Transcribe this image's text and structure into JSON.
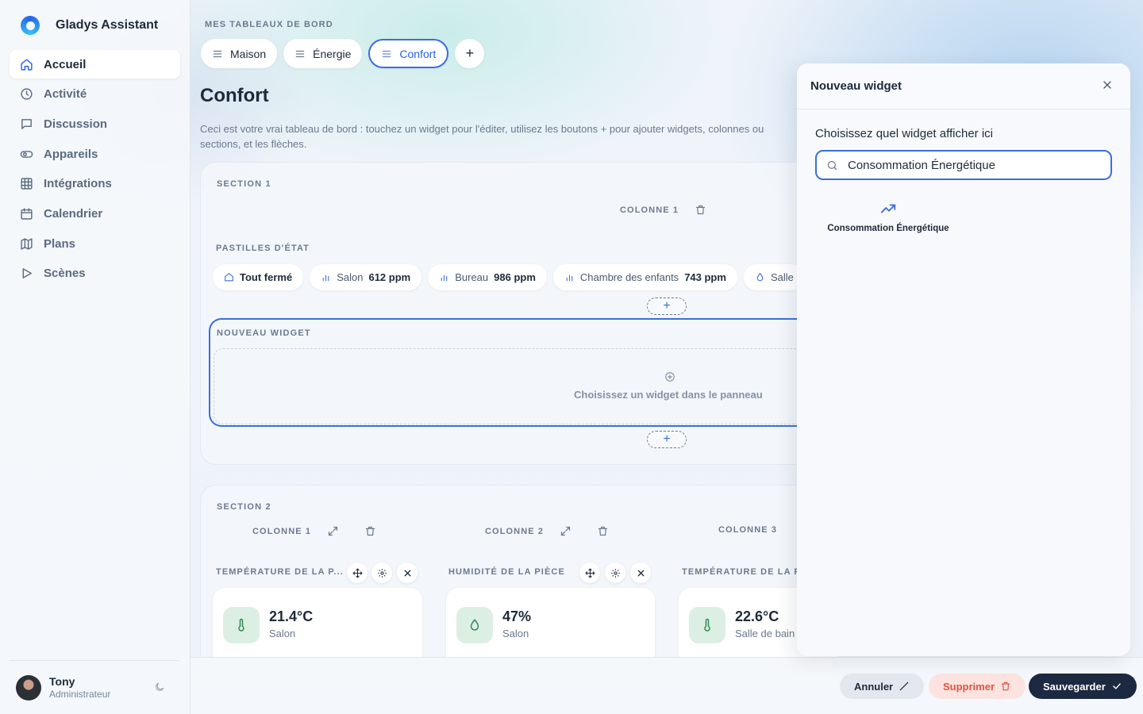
{
  "sidebar": {
    "brand": "Gladys Assistant",
    "items": [
      {
        "label": "Accueil",
        "icon": "home-icon",
        "active": true
      },
      {
        "label": "Activité",
        "icon": "clock-icon"
      },
      {
        "label": "Discussion",
        "icon": "chat-icon"
      },
      {
        "label": "Appareils",
        "icon": "toggle-icon"
      },
      {
        "label": "Intégrations",
        "icon": "grid-icon"
      },
      {
        "label": "Calendrier",
        "icon": "calendar-icon"
      },
      {
        "label": "Plans",
        "icon": "map-icon"
      },
      {
        "label": "Scènes",
        "icon": "play-icon"
      }
    ],
    "user": {
      "name": "Tony",
      "role": "Administrateur"
    }
  },
  "dashboard": {
    "section_label": "MES TABLEAUX DE BORD",
    "tabs": [
      {
        "label": "Maison"
      },
      {
        "label": "Énergie"
      },
      {
        "label": "Confort",
        "active": true
      }
    ],
    "add_tab": "+",
    "title": "Confort",
    "description": "Ceci est votre vrai tableau de bord : touchez un widget pour l'éditer, utilisez les boutons + pour ajouter widgets, colonnes ou sections, et les flèches."
  },
  "section1": {
    "title": "SECTION 1",
    "column_label": "COLONNE 1",
    "pills_label": "PASTILLES D'ÉTAT",
    "pills": [
      {
        "icon": "home-icon",
        "name": "",
        "value": "Tout fermé"
      },
      {
        "icon": "bar-chart-icon",
        "name": "Salon",
        "value": "612 ppm"
      },
      {
        "icon": "bar-chart-icon",
        "name": "Bureau",
        "value": "986 ppm"
      },
      {
        "icon": "bar-chart-icon",
        "name": "Chambre des enfants",
        "value": "743 ppm"
      },
      {
        "icon": "drop-icon",
        "name": "Salle",
        "value": ""
      }
    ],
    "add": "+",
    "new_widget": {
      "title": "NOUVEAU WIDGET",
      "hint": "Choisissez un widget dans le panneau"
    }
  },
  "section2": {
    "title": "SECTION 2",
    "columns": [
      {
        "label": "COLONNE 1"
      },
      {
        "label": "COLONNE 2"
      },
      {
        "label": "COLONNE 3"
      }
    ],
    "widgets": [
      {
        "title": "TEMPÉRATURE DE LA P...",
        "value": "21.4°C",
        "room": "Salon",
        "icon": "thermometer-icon"
      },
      {
        "title": "HUMIDITÉ DE LA PIÈCE",
        "value": "47%",
        "room": "Salon",
        "icon": "drop-icon"
      },
      {
        "title": "TEMPÉRATURE DE LA P",
        "value": "22.6°C",
        "room": "Salle de bain",
        "icon": "thermometer-icon"
      }
    ]
  },
  "footer": {
    "cancel": "Annuler",
    "delete": "Supprimer",
    "save": "Sauvegarder"
  },
  "panel": {
    "title": "Nouveau widget",
    "prompt": "Choisissez quel widget afficher ici",
    "search_value": "Consommation Énergétique",
    "results": [
      {
        "label": "Consommation Énergétique",
        "icon": "trending-up-icon"
      }
    ]
  },
  "colors": {
    "accent": "#3b6fdc",
    "dark_button": "#1c2940",
    "danger": "#e0533f",
    "danger_bg": "#fde3e0",
    "icon_tile": "#dcefe3"
  }
}
